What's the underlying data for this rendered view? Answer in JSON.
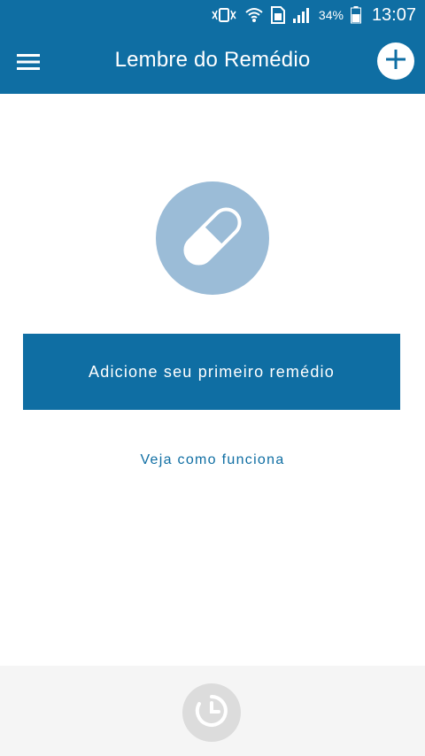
{
  "status_bar": {
    "battery_percent": "34%",
    "time": "13:07",
    "icons": [
      "vibrate-icon",
      "wifi-icon",
      "sim-icon",
      "signal-icon",
      "battery-icon"
    ]
  },
  "app_bar": {
    "title": "Lembre do Remédio",
    "menu_icon": "hamburger-menu-icon",
    "add_icon": "plus-icon"
  },
  "main": {
    "illustration_icon": "pill-icon",
    "primary_button_label": "Adicione seu primeiro remédio",
    "help_link_label": "Veja como funciona"
  },
  "bottom": {
    "history_icon": "clock-icon"
  },
  "colors": {
    "primary": "#0f6ea3",
    "pill_circle": "#9bbcd7",
    "bottom_background": "#f5f5f5"
  }
}
